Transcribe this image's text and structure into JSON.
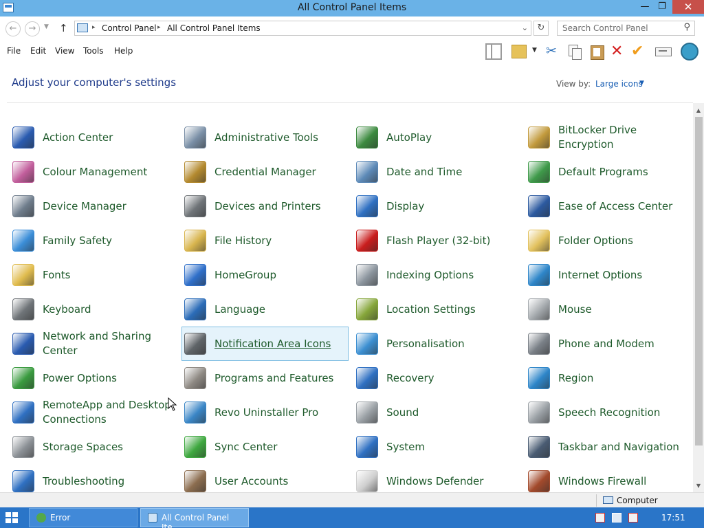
{
  "window": {
    "title": "All Control Panel Items",
    "min_glyph": "—",
    "max_glyph": "❐",
    "close_glyph": "✕"
  },
  "nav": {
    "back_glyph": "←",
    "forward_glyph": "→",
    "recent_glyph": "▼",
    "up_glyph": "↑",
    "refresh_glyph": "↻",
    "dropdown_glyph": "⌄"
  },
  "address": {
    "crumbs": [
      "Control Panel",
      "All Control Panel Items"
    ],
    "sep_glyph": "▸"
  },
  "search": {
    "placeholder": "Search Control Panel",
    "icon_glyph": "⚲"
  },
  "menu": [
    "File",
    "Edit",
    "View",
    "Tools",
    "Help"
  ],
  "toolbar": {
    "cut_glyph": "✂",
    "delete_glyph": "✕",
    "props_glyph": "✔",
    "dd_glyph": "▼"
  },
  "header": {
    "title": "Adjust your computer's settings",
    "view_by_label": "View by:",
    "view_by_value": "Large icons",
    "view_by_arrow": "▼"
  },
  "items": [
    {
      "label": "Action Center",
      "icon": "flag-icon",
      "color": "#2a5bb0"
    },
    {
      "label": "Administrative Tools",
      "icon": "gear-checklist-icon",
      "color": "#7a8fa6"
    },
    {
      "label": "AutoPlay",
      "icon": "play-screen-icon",
      "color": "#3c8a3f"
    },
    {
      "label": "BitLocker Drive Encryption",
      "icon": "key-drive-icon",
      "color": "#c29a3c"
    },
    {
      "label": "Colour Management",
      "icon": "color-monitor-icon",
      "color": "#c25e9c"
    },
    {
      "label": "Credential Manager",
      "icon": "vault-icon",
      "color": "#b48a2f"
    },
    {
      "label": "Date and Time",
      "icon": "calendar-clock-icon",
      "color": "#5d8ab8"
    },
    {
      "label": "Default Programs",
      "icon": "default-programs-icon",
      "color": "#3f9a4a"
    },
    {
      "label": "Device Manager",
      "icon": "device-manager-icon",
      "color": "#6f7d8c"
    },
    {
      "label": "Devices and Printers",
      "icon": "printer-icon",
      "color": "#6f7478"
    },
    {
      "label": "Display",
      "icon": "monitor-icon",
      "color": "#2f70c2"
    },
    {
      "label": "Ease of Access Center",
      "icon": "ease-of-access-icon",
      "color": "#2c5aa0"
    },
    {
      "label": "Family Safety",
      "icon": "family-icon",
      "color": "#3b8ed8"
    },
    {
      "label": "File History",
      "icon": "file-history-icon",
      "color": "#d8b54e"
    },
    {
      "label": "Flash Player (32-bit)",
      "icon": "flash-icon",
      "color": "#c91d1d"
    },
    {
      "label": "Folder Options",
      "icon": "folder-options-icon",
      "color": "#e2c15d"
    },
    {
      "label": "Fonts",
      "icon": "fonts-folder-icon",
      "color": "#e0bc4e"
    },
    {
      "label": "HomeGroup",
      "icon": "homegroup-icon",
      "color": "#2f6fc9"
    },
    {
      "label": "Indexing Options",
      "icon": "indexing-icon",
      "color": "#8c959e"
    },
    {
      "label": "Internet Options",
      "icon": "internet-options-icon",
      "color": "#2e86c9"
    },
    {
      "label": "Keyboard",
      "icon": "keyboard-icon",
      "color": "#6f7478"
    },
    {
      "label": "Language",
      "icon": "language-icon",
      "color": "#2b6cb8"
    },
    {
      "label": "Location Settings",
      "icon": "location-icon",
      "color": "#86a63a"
    },
    {
      "label": "Mouse",
      "icon": "mouse-icon",
      "color": "#a4a9ad"
    },
    {
      "label": "Network and Sharing Center",
      "icon": "network-icon",
      "color": "#2a5bb0"
    },
    {
      "label": "Notification Area Icons",
      "icon": "notification-area-icon",
      "color": "#5f6468"
    },
    {
      "label": "Personalisation",
      "icon": "personalisation-icon",
      "color": "#3c8fd1"
    },
    {
      "label": "Phone and Modem",
      "icon": "phone-icon",
      "color": "#7a8087"
    },
    {
      "label": "Power Options",
      "icon": "power-icon",
      "color": "#3a9b3f"
    },
    {
      "label": "Programs and Features",
      "icon": "programs-icon",
      "color": "#8f8a84"
    },
    {
      "label": "Recovery",
      "icon": "recovery-icon",
      "color": "#2f70c2"
    },
    {
      "label": "Region",
      "icon": "region-icon",
      "color": "#2e86c9"
    },
    {
      "label": "RemoteApp and Desktop Connections",
      "icon": "remoteapp-icon",
      "color": "#2f70c2"
    },
    {
      "label": "Revo Uninstaller Pro",
      "icon": "revo-icon",
      "color": "#3a86c6"
    },
    {
      "label": "Sound",
      "icon": "speaker-icon",
      "color": "#9aa0a5"
    },
    {
      "label": "Speech Recognition",
      "icon": "microphone-icon",
      "color": "#9aa0a5"
    },
    {
      "label": "Storage Spaces",
      "icon": "storage-icon",
      "color": "#8c9196"
    },
    {
      "label": "Sync Center",
      "icon": "sync-icon",
      "color": "#3ea83f"
    },
    {
      "label": "System",
      "icon": "system-icon",
      "color": "#2f70c2"
    },
    {
      "label": "Taskbar and Navigation",
      "icon": "taskbar-icon",
      "color": "#4a5c73"
    },
    {
      "label": "Troubleshooting",
      "icon": "troubleshoot-icon",
      "color": "#2f70c2"
    },
    {
      "label": "User Accounts",
      "icon": "users-icon",
      "color": "#8c6d4f"
    },
    {
      "label": "Windows Defender",
      "icon": "defender-icon",
      "color": "#cfcfcf"
    },
    {
      "label": "Windows Firewall",
      "icon": "firewall-icon",
      "color": "#a34a2c"
    }
  ],
  "selected_item": "Notification Area Icons",
  "statusbar": {
    "location": "Computer"
  },
  "scrollbar": {
    "up_glyph": "▲",
    "down_glyph": "▼"
  },
  "taskbar": {
    "tasks": [
      {
        "label": "Error",
        "icon": "error-app-icon",
        "color": "#54a84b"
      },
      {
        "label": "All Control Panel Ite...",
        "icon": "control-panel-icon",
        "color": "#cfe3f5"
      }
    ],
    "clock": "17:51"
  },
  "colors": {
    "titlebar": "#6ab2e7",
    "taskbar": "#2a75c8",
    "item_text": "#1e5a2b",
    "heading": "#1e3a8a",
    "link": "#1a5fb4"
  }
}
